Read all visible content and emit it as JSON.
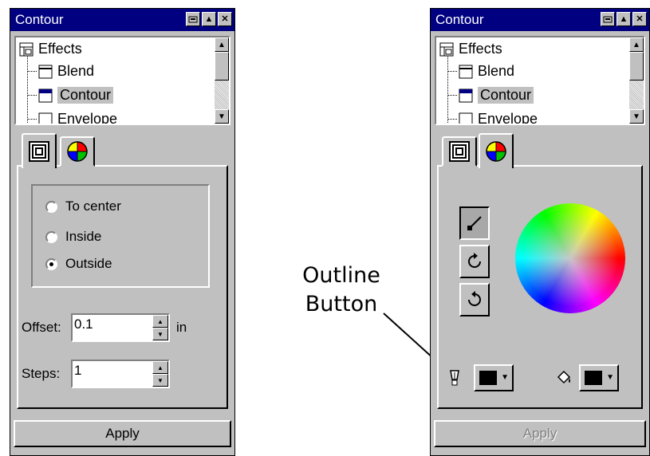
{
  "left_panel": {
    "title": "Contour",
    "tree": {
      "root": "Effects",
      "items": [
        "Blend",
        "Contour",
        "Envelope"
      ],
      "selected": "Contour"
    },
    "tabs": [
      {
        "icon": "concentric-squares-icon",
        "active": true
      },
      {
        "icon": "color-wheel-icon",
        "active": false
      }
    ],
    "radios": [
      {
        "label": "To center",
        "checked": false
      },
      {
        "label": "Inside",
        "checked": false
      },
      {
        "label": "Outside",
        "checked": true
      }
    ],
    "offset": {
      "label": "Offset:",
      "value": "0.1",
      "unit": "in"
    },
    "steps": {
      "label": "Steps:",
      "value": "1"
    },
    "apply_label": "Apply"
  },
  "right_panel": {
    "title": "Contour",
    "tree": {
      "root": "Effects",
      "items": [
        "Blend",
        "Contour",
        "Envelope"
      ],
      "selected": "Contour"
    },
    "tabs": [
      {
        "icon": "concentric-squares-icon",
        "active": false
      },
      {
        "icon": "color-wheel-icon",
        "active": true
      }
    ],
    "tool_buttons": [
      "outline-line-icon",
      "clockwise-icon",
      "counterclockwise-icon"
    ],
    "outline_color": "#000000",
    "fill_color": "#000000",
    "apply_label": "Apply",
    "apply_disabled": true
  },
  "annotation": {
    "line1": "Outline",
    "line2": "Button"
  }
}
